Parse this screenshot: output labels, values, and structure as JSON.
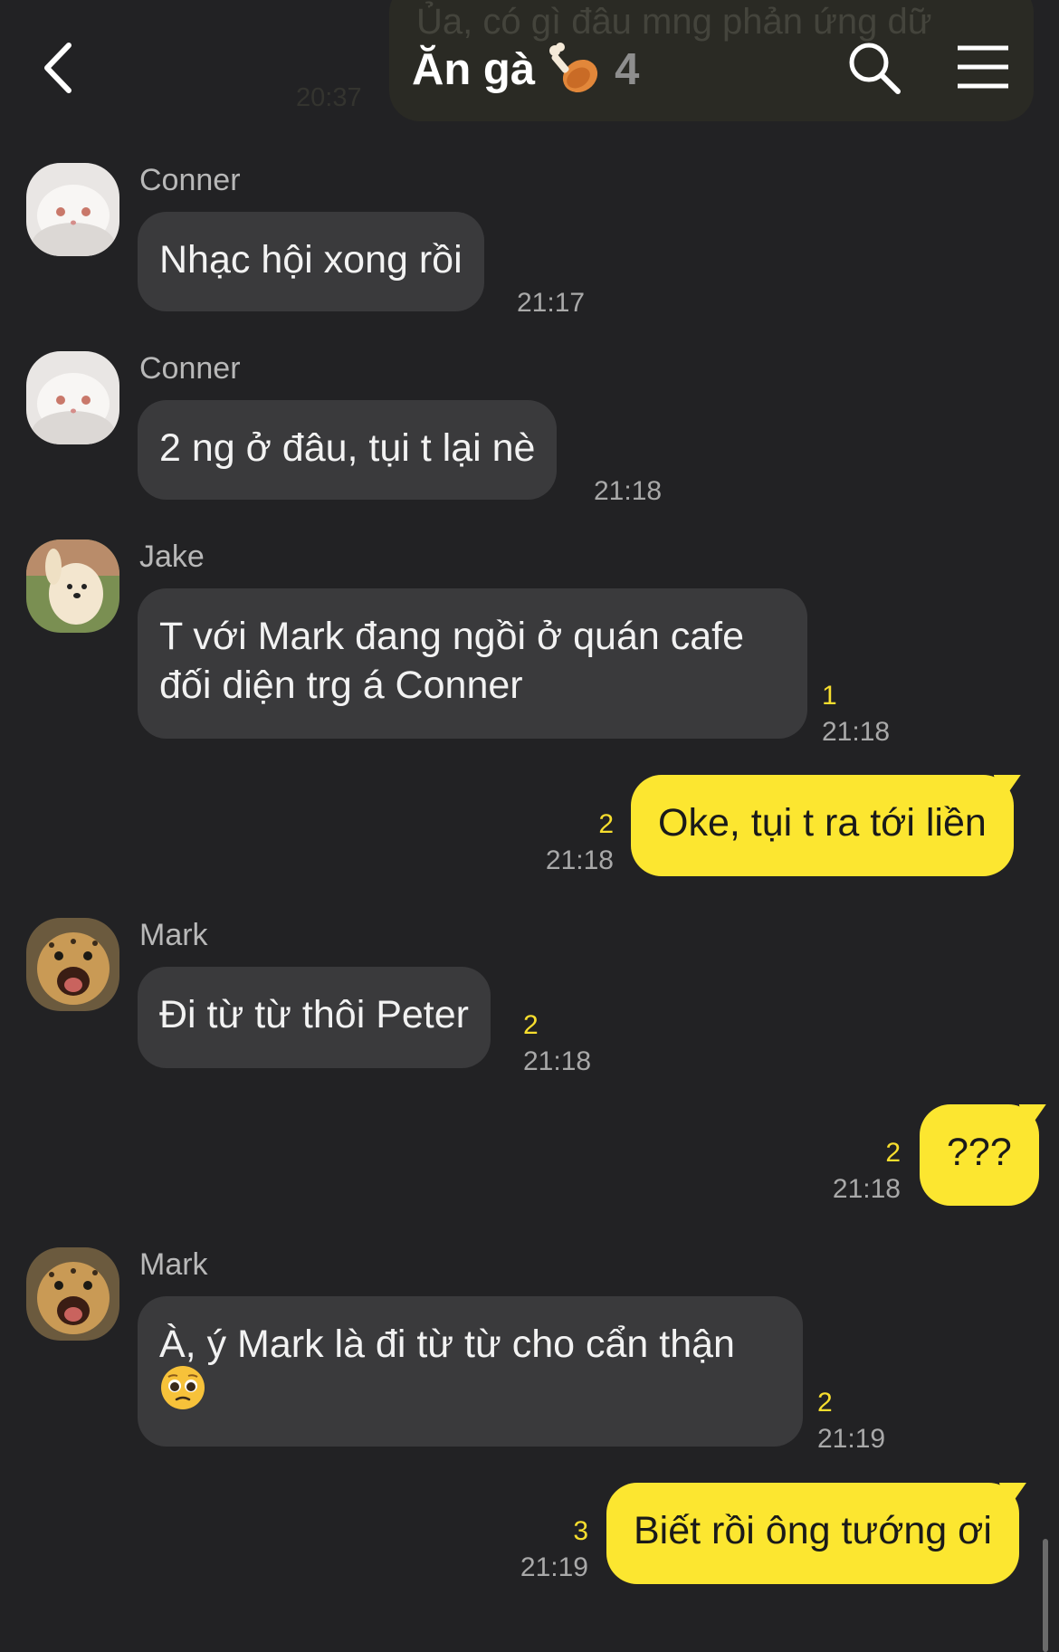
{
  "background_message": {
    "text": "Ủa, có gì đâu mng phản ứng dữ",
    "time": "20:37"
  },
  "header": {
    "title": "Ăn gà",
    "title_emoji": "poultry-leg-icon",
    "member_count": "4",
    "icons": [
      "back-icon",
      "search-icon",
      "menu-icon"
    ]
  },
  "colors": {
    "background": "#222224",
    "incoming_bubble": "#3a3a3c",
    "outgoing_bubble": "#fce630",
    "unread_count": "#f7de2e"
  },
  "messages": [
    {
      "sender": "Conner",
      "text": "Nhạc hội xong rồi",
      "time": "21:17",
      "unread": ""
    },
    {
      "sender": "Conner",
      "text": "2 ng ở đâu, tụi t lại nè",
      "time": "21:18",
      "unread": ""
    },
    {
      "sender": "Jake",
      "line1": "T với Mark đang ngồi ở quán cafe",
      "line2": "đối diện trg á Conner",
      "time": "21:18",
      "unread": "1"
    },
    {
      "sender": "me",
      "text": "Oke, tụi t ra tới liền",
      "time": "21:18",
      "unread": "2"
    },
    {
      "sender": "Mark",
      "text": "Đi từ từ thôi Peter",
      "time": "21:18",
      "unread": "2"
    },
    {
      "sender": "me",
      "text": "???",
      "time": "21:18",
      "unread": "2"
    },
    {
      "sender": "Mark",
      "line1": "À, ý Mark là đi từ từ cho cẩn thận",
      "emoji": "pleading-face-icon",
      "time": "21:19",
      "unread": "2"
    },
    {
      "sender": "me",
      "text": "Biết rồi ông tướng ơi",
      "time": "21:19",
      "unread": "3"
    }
  ]
}
